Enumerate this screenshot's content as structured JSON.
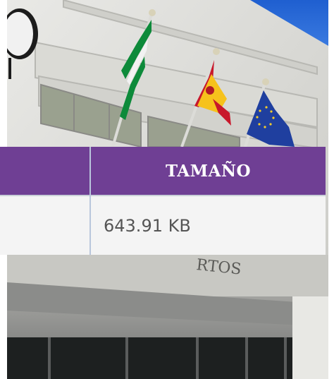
{
  "table": {
    "columns": [
      "",
      "TAMAÑO"
    ],
    "rows": [
      [
        "",
        "643.91 KB"
      ]
    ]
  },
  "photo": {
    "signage_partial_left": "U",
    "signage_partial_bottom": "RTOS",
    "flags": [
      "andalusia-flag",
      "spain-flag",
      "eu-flag"
    ]
  },
  "colors": {
    "header_bg": "#6f3f94",
    "header_text": "#ffffff",
    "cell_bg": "#f4f4f4",
    "cell_text": "#555555",
    "divider": "#b9c6dc"
  }
}
